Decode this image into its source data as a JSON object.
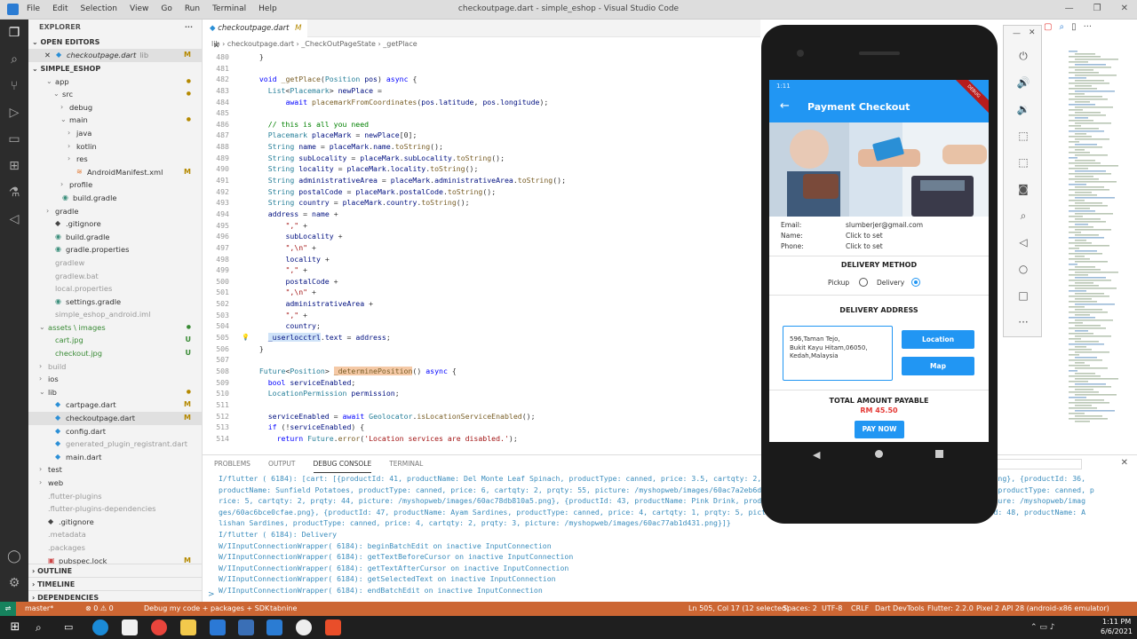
{
  "window": {
    "title": "checkoutpage.dart - simple_eshop - Visual Studio Code",
    "menu": [
      "File",
      "Edit",
      "Selection",
      "View",
      "Go",
      "Run",
      "Terminal",
      "Help"
    ]
  },
  "sidebar": {
    "explorer_label": "EXPLORER",
    "open_editors_label": "OPEN EDITORS",
    "open_file": {
      "name": "checkoutpage.dart",
      "path": "lib",
      "badge": "M"
    },
    "project_label": "SIMPLE_ESHOP",
    "tree": [
      {
        "label": "app",
        "indent": 2,
        "chev": "⌄",
        "badge": "",
        "dot": true
      },
      {
        "label": "src",
        "indent": 3,
        "chev": "⌄",
        "badge": "",
        "dot": true
      },
      {
        "label": "debug",
        "indent": 4,
        "chev": "›",
        "badge": ""
      },
      {
        "label": "main",
        "indent": 4,
        "chev": "⌄",
        "badge": "",
        "dot": true
      },
      {
        "label": "java",
        "indent": 5,
        "chev": "›",
        "badge": ""
      },
      {
        "label": "kotlin",
        "indent": 5,
        "chev": "›",
        "badge": ""
      },
      {
        "label": "res",
        "indent": 5,
        "chev": "›",
        "badge": ""
      },
      {
        "label": "AndroidManifest.xml",
        "indent": 5,
        "chev": "",
        "badge": "M",
        "icon": "rss"
      },
      {
        "label": "profile",
        "indent": 4,
        "chev": "›",
        "badge": ""
      },
      {
        "label": "build.gradle",
        "indent": 3,
        "chev": "",
        "badge": "",
        "icon": "gradle"
      },
      {
        "label": "gradle",
        "indent": 2,
        "chev": "›",
        "badge": ""
      },
      {
        "label": ".gitignore",
        "indent": 2,
        "chev": "",
        "badge": "",
        "icon": "git"
      },
      {
        "label": "build.gradle",
        "indent": 2,
        "chev": "",
        "badge": "",
        "icon": "gradle"
      },
      {
        "label": "gradle.properties",
        "indent": 2,
        "chev": "",
        "badge": "",
        "icon": "gradle"
      },
      {
        "label": "gradlew",
        "indent": 2,
        "chev": "",
        "badge": "",
        "gray": true
      },
      {
        "label": "gradlew.bat",
        "indent": 2,
        "chev": "",
        "badge": "",
        "gray": true
      },
      {
        "label": "local.properties",
        "indent": 2,
        "chev": "",
        "badge": "",
        "gray": true
      },
      {
        "label": "settings.gradle",
        "indent": 2,
        "chev": "",
        "badge": "",
        "icon": "gradle"
      },
      {
        "label": "simple_eshop_android.iml",
        "indent": 2,
        "chev": "",
        "badge": "",
        "gray": true
      },
      {
        "label": "assets \\ images",
        "indent": 1,
        "chev": "⌄",
        "badge": "",
        "dot": true,
        "green": true
      },
      {
        "label": "cart.jpg",
        "indent": 2,
        "chev": "",
        "badge": "U",
        "green": true
      },
      {
        "label": "checkout.jpg",
        "indent": 2,
        "chev": "",
        "badge": "U",
        "green": true
      },
      {
        "label": "build",
        "indent": 1,
        "chev": "›",
        "badge": "",
        "gray": true
      },
      {
        "label": "ios",
        "indent": 1,
        "chev": "›",
        "badge": ""
      },
      {
        "label": "lib",
        "indent": 1,
        "chev": "⌄",
        "badge": "",
        "dot": true
      },
      {
        "label": "cartpage.dart",
        "indent": 2,
        "chev": "",
        "badge": "M",
        "icon": "dart"
      },
      {
        "label": "checkoutpage.dart",
        "indent": 2,
        "chev": "",
        "badge": "M",
        "icon": "dart",
        "selected": true
      },
      {
        "label": "config.dart",
        "indent": 2,
        "chev": "",
        "badge": "",
        "icon": "dart"
      },
      {
        "label": "generated_plugin_registrant.dart",
        "indent": 2,
        "chev": "",
        "badge": "",
        "icon": "dart",
        "gray": true
      },
      {
        "label": "main.dart",
        "indent": 2,
        "chev": "",
        "badge": "",
        "icon": "dart"
      },
      {
        "label": "test",
        "indent": 1,
        "chev": "›",
        "badge": ""
      },
      {
        "label": "web",
        "indent": 1,
        "chev": "›",
        "badge": ""
      },
      {
        "label": ".flutter-plugins",
        "indent": 1,
        "chev": "",
        "badge": "",
        "gray": true
      },
      {
        "label": ".flutter-plugins-dependencies",
        "indent": 1,
        "chev": "",
        "badge": "",
        "gray": true
      },
      {
        "label": ".gitignore",
        "indent": 1,
        "chev": "",
        "badge": "",
        "icon": "git"
      },
      {
        "label": ".metadata",
        "indent": 1,
        "chev": "",
        "badge": "",
        "gray": true
      },
      {
        "label": ".packages",
        "indent": 1,
        "chev": "",
        "badge": "",
        "gray": true
      },
      {
        "label": "pubspec.lock",
        "indent": 1,
        "chev": "",
        "badge": "M",
        "icon": "lock"
      }
    ],
    "outline_label": "OUTLINE",
    "timeline_label": "TIMELINE",
    "dependencies_label": "DEPENDENCIES"
  },
  "editor": {
    "tab_label": "checkoutpage.dart",
    "tab_badge": "M",
    "breadcrumb": [
      "lib",
      "checkoutpage.dart",
      "_CheckOutPageState",
      "_getPlace"
    ],
    "first_line": 480,
    "lines": [
      "  }",
      "",
      "  void _getPlace(Position pos) async {",
      "    List<Placemark> newPlace =",
      "        await placemarkFromCoordinates(pos.latitude, pos.longitude);",
      "",
      "    // this is all you need",
      "    Placemark placeMark = newPlace[0];",
      "    String name = placeMark.name.toString();",
      "    String subLocality = placeMark.subLocality.toString();",
      "    String locality = placeMark.locality.toString();",
      "    String administrativeArea = placeMark.administrativeArea.toString();",
      "    String postalCode = placeMark.postalCode.toString();",
      "    String country = placeMark.country.toString();",
      "    address = name +",
      "        \",\" +",
      "        subLocality +",
      "        \",\\n\" +",
      "        locality +",
      "        \",\" +",
      "        postalCode +",
      "        \",\\n\" +",
      "        administrativeArea +",
      "        \",\" +",
      "        country;",
      "    _userlocctrl.text = address;",
      "  }",
      "",
      "  Future<Position> _determinePosition() async {",
      "    bool serviceEnabled;",
      "    LocationPermission permission;",
      "",
      "    serviceEnabled = await Geolocator.isLocationServiceEnabled();",
      "    if (!serviceEnabled) {",
      "      return Future.error('Location services are disabled.');"
    ]
  },
  "panel": {
    "tabs": [
      "PROBLEMS",
      "OUTPUT",
      "DEBUG CONSOLE",
      "TERMINAL"
    ],
    "active_tab": "DEBUG CONSOLE",
    "console_lines": [
      "I/flutter ( 6184): [cart: [{productId: 41, productName: Del Monte Leaf Spinach, productType: canned, price: 3.5, cartqty: 2, prqty: 15, picture: /myshopweb/images/60ac7b3c0a035.png}, {productId: 36,",
      "productName: Sunfield  Potatoes, productType: canned, price: 6, cartqty: 2, prqty: 55, picture: /myshopweb/images/60ac7a2eb6d67.png}, {productId: 37, productName: Gardenia Bread, productType: canned, p",
      "rice: 5, cartqty: 2, prqty: 44, picture: /myshopweb/images/60ac78db810a5.png}, {productId: 43, productName: Pink Drink, productType: canned, price: 3, cartqty: 2, prqty: 10, picture: /myshopweb/imag",
      "ges/60ac6bce0cfae.png}, {productId: 47, productName: Ayam Sardines, productType: canned, price: 4, cartqty: 1, prqty: 5, picture: /myshopweb/images/60ac7a9f2c1e1.png}, {productId: 48, productName: A",
      "lishan Sardines, productType: canned, price: 4, cartqty: 2, prqty: 3, picture: /myshopweb/images/60ac77ab1d431.png}]}",
      "I/flutter ( 6184): Delivery",
      "W/IInputConnectionWrapper( 6184): beginBatchEdit on inactive InputConnection",
      "W/IInputConnectionWrapper( 6184): getTextBeforeCursor on inactive InputConnection",
      "W/IInputConnectionWrapper( 6184): getTextAfterCursor on inactive InputConnection",
      "W/IInputConnectionWrapper( 6184): getSelectedText on inactive InputConnection",
      "W/IInputConnectionWrapper( 6184): endBatchEdit on inactive InputConnection"
    ],
    "prompt": ">"
  },
  "statusbar": {
    "branch": "master*",
    "problems": "⊗ 0  ⚠ 0",
    "debug": "Debug my code + packages + SDK",
    "tabnine": "tabnine",
    "position": "Ln 505, Col 17 (12 selected)",
    "spaces": "Spaces: 2",
    "encoding": "UTF-8",
    "eol": "CRLF",
    "devtools": "Dart DevTools",
    "flutter": "Flutter: 2.2.0",
    "device": "Pixel 2 API 28 (android-x86 emulator)"
  },
  "taskbar": {
    "time": "1:11 PM",
    "date": "6/6/2021"
  },
  "phone": {
    "status_time": "1:11",
    "debug_ribbon": "DEBUG",
    "app_title": "Payment Checkout",
    "email_label": "Email:",
    "email_value": "slumberjer@gmail.com",
    "name_label": "Name:",
    "name_value": "Click to set",
    "phone_label": "Phone:",
    "phone_value": "Click to set",
    "delivery_method_title": "DELIVERY METHOD",
    "pickup_label": "Pickup",
    "delivery_label": "Delivery",
    "selected_method": "Delivery",
    "delivery_address_title": "DELIVERY ADDRESS",
    "address_lines": [
      "596,Taman Tejo,",
      "Bukit Kayu Hitam,06050,",
      "Kedah,Malaysia"
    ],
    "location_button": "Location",
    "map_button": "Map",
    "total_title": "TOTAL AMOUNT PAYABLE",
    "total_value": "RM 45.50",
    "pay_button": "PAY NOW"
  },
  "colors": {
    "statusbar": "#cc6633",
    "accent": "#2196f3",
    "total": "#e53935"
  }
}
